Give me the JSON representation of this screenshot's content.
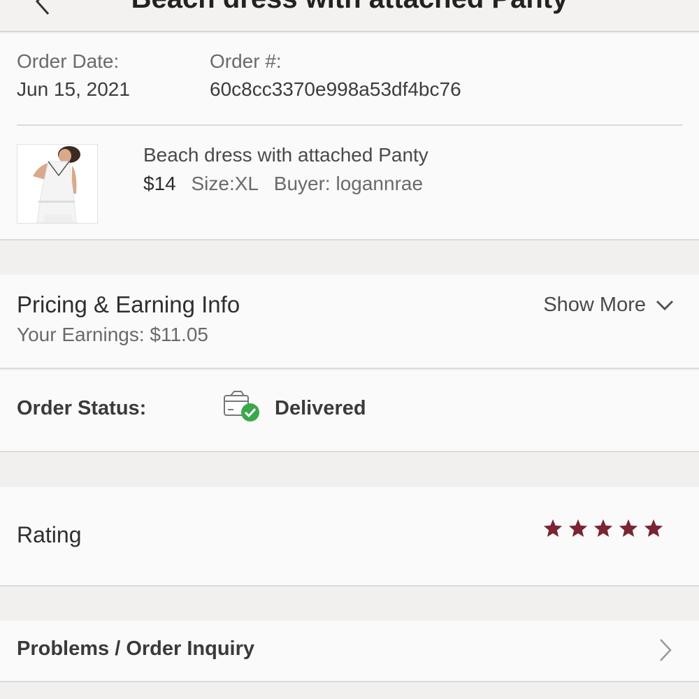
{
  "header": {
    "title": "Beach dress with attached Panty"
  },
  "order": {
    "date_label": "Order Date:",
    "date_value": "Jun 15, 2021",
    "number_label": "Order #:",
    "number_value": "60c8cc3370e998a53df4bc76"
  },
  "item": {
    "title": "Beach dress with attached Panty",
    "price": "$14",
    "size": "Size:XL",
    "buyer": "Buyer: logannrae"
  },
  "pricing": {
    "title": "Pricing & Earning Info",
    "earnings": "Your Earnings: $11.05",
    "show_more": "Show More"
  },
  "status": {
    "label": "Order Status:",
    "value": "Delivered",
    "icon": "delivered-box-icon",
    "check_color": "#3aa84a"
  },
  "rating": {
    "label": "Rating",
    "stars": 5,
    "max_stars": 5,
    "star_color": "#7a2434"
  },
  "problems": {
    "label": "Problems / Order Inquiry"
  }
}
